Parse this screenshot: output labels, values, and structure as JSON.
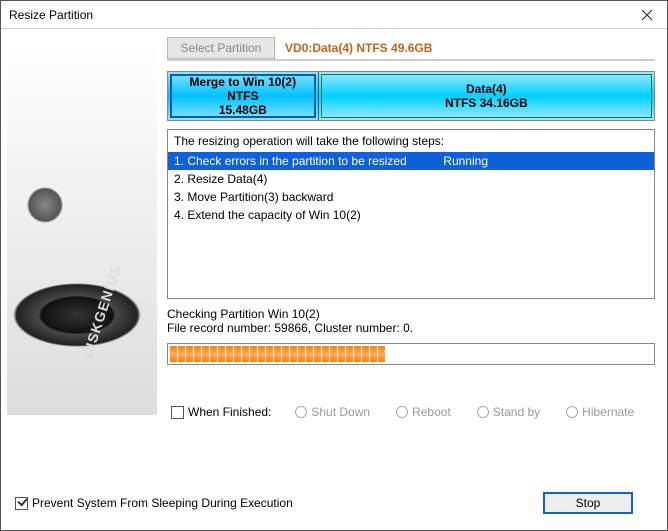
{
  "title": "Resize Partition",
  "select_btn": "Select Partition",
  "selected_partition": "VD0:Data(4) NTFS 49.6GB",
  "part_a": {
    "line1": "Merge to Win 10(2)",
    "line2": "NTFS",
    "line3": "15.48GB"
  },
  "part_b": {
    "line1": "Data(4)",
    "line2": "NTFS 34.16GB"
  },
  "steps_title": "The resizing operation will take the following steps:",
  "steps": [
    {
      "text": "1. Check errors in the partition to be resized",
      "status": "Running",
      "running": true
    },
    {
      "text": "2. Resize Data(4)"
    },
    {
      "text": "3. Move Partition(3) backward"
    },
    {
      "text": "4. Extend the capacity of Win 10(2)"
    }
  ],
  "status_line1": "Checking Partition Win 10(2)",
  "status_line2": "File record number: 59866, Cluster number: 0.",
  "progress_segments": 27,
  "when_finished_label": "When Finished:",
  "radios": [
    "Shut Down",
    "Reboot",
    "Stand by",
    "Hibernate"
  ],
  "prevent_sleep": "Prevent System From Sleeping During Execution",
  "stop": "Stop"
}
